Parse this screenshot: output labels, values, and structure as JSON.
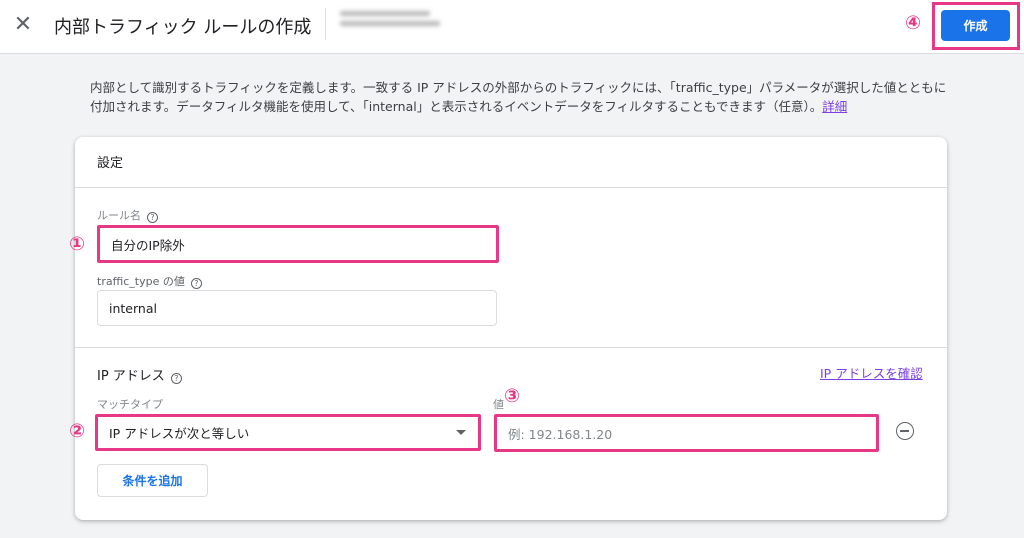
{
  "header": {
    "close_icon": "close-icon",
    "title": "内部トラフィック ルールの作成",
    "create_label": "作成"
  },
  "badges": [
    "①",
    "②",
    "③",
    "④"
  ],
  "description": {
    "text": "内部として識別するトラフィックを定義します。一致する IP アドレスの外部からのトラフィックには、「traffic_type」パラメータが選択した値とともに付加されます。データフィルタ機能を使用して、「internal」と表示されるイベントデータをフィルタすることもできます（任意）。",
    "link": "詳細"
  },
  "settings": {
    "title": "設定",
    "rule_name_label": "ルール名",
    "rule_name_value": "自分のIP除外",
    "traffic_type_label": "traffic_type の値",
    "traffic_type_value": "internal"
  },
  "ip": {
    "title": "IP アドレス",
    "check_link": "IP アドレスを確認",
    "match_type_label": "マッチタイプ",
    "match_type_value": "IP アドレスが次と等しい",
    "value_label": "値",
    "value_placeholder": "例: 192.168.1.20",
    "add_condition_label": "条件を追加"
  },
  "colors": {
    "accent": "#1a73e8",
    "highlight": "#e63887",
    "link": "#7b3fe4"
  }
}
